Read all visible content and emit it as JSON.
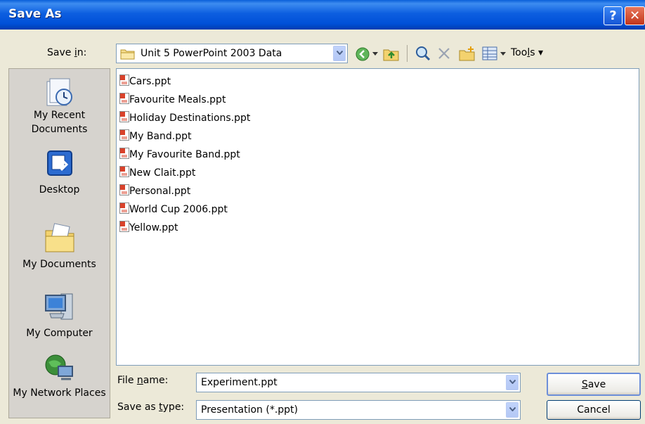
{
  "window": {
    "title": "Save As",
    "help_glyph": "?",
    "close_glyph": "✕"
  },
  "save_in": {
    "label_pre": "Save ",
    "label_key": "i",
    "label_post": "n:",
    "value": "Unit 5 PowerPoint 2003 Data"
  },
  "toolbar": {
    "tools_pre": "Too",
    "tools_key": "l",
    "tools_post": "s",
    "menu_arrow": "▾"
  },
  "places": [
    {
      "label": "My Recent Documents",
      "icon": "recent-documents-icon"
    },
    {
      "label": "Desktop",
      "icon": "desktop-icon"
    },
    {
      "label": "My Documents",
      "icon": "my-documents-icon"
    },
    {
      "label": "My Computer",
      "icon": "my-computer-icon"
    },
    {
      "label": "My Network Places",
      "icon": "network-places-icon"
    }
  ],
  "files": [
    "Cars.ppt",
    "Favourite Meals.ppt",
    "Holiday Destinations.ppt",
    "My Band.ppt",
    "My Favourite Band.ppt",
    "New Clait.ppt",
    "Personal.ppt",
    "World Cup 2006.ppt",
    "Yellow.ppt"
  ],
  "file_name": {
    "label_pre": "File ",
    "label_key": "n",
    "label_post": "ame:",
    "value": "Experiment.ppt"
  },
  "save_type": {
    "label_pre": "Save as ",
    "label_key": "t",
    "label_post": "ype:",
    "value": "Presentation (*.ppt)"
  },
  "buttons": {
    "save_key": "S",
    "save_rest": "ave",
    "cancel": "Cancel"
  }
}
